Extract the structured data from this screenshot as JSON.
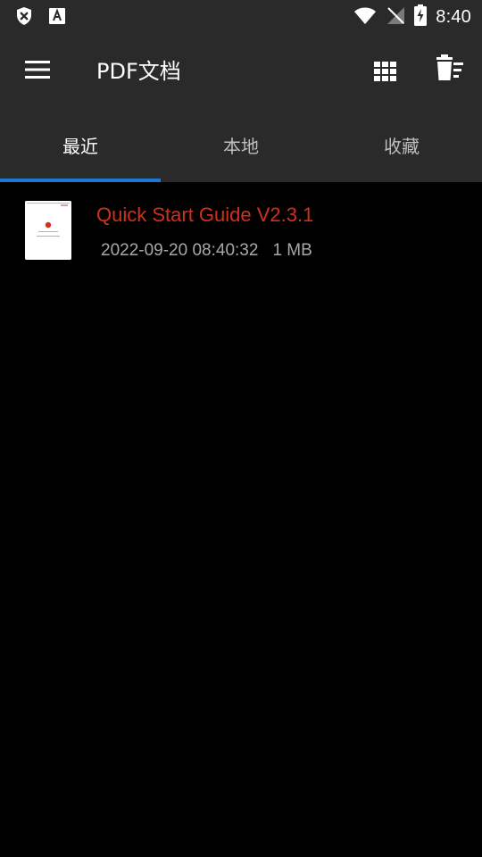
{
  "status_bar": {
    "time": "8:40",
    "left_icons": [
      "shield-x-icon",
      "font-a-icon"
    ],
    "right_icons": [
      "wifi-icon",
      "no-signal-icon",
      "battery-charging-icon"
    ]
  },
  "app_bar": {
    "title": "PDF文档",
    "menu_icon": "hamburger-menu-icon",
    "grid_icon": "grid-view-icon",
    "trash_icon": "delete-list-icon"
  },
  "tabs": [
    {
      "label": "最近",
      "active": true
    },
    {
      "label": "本地",
      "active": false
    },
    {
      "label": "收藏",
      "active": false
    }
  ],
  "files": [
    {
      "name": "Quick Start Guide V2.3.1",
      "date": "2022-09-20 08:40:32",
      "size": "1 MB"
    }
  ],
  "colors": {
    "bar_background": "#2a2a2a",
    "background": "#000000",
    "accent": "#1e78d6",
    "file_name": "#d0311c",
    "meta_text": "#a8a8a8"
  }
}
